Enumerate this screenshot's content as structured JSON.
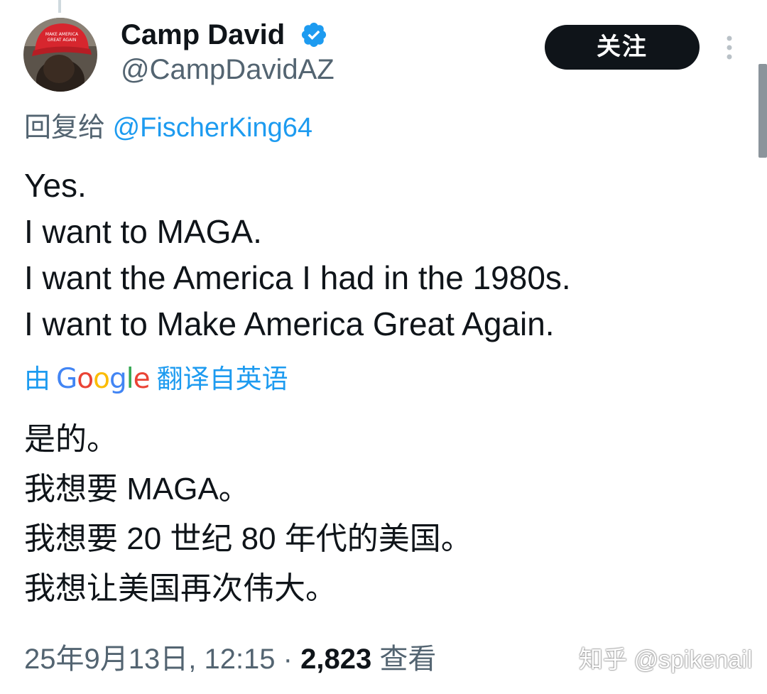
{
  "author": {
    "display_name": "Camp David",
    "handle": "@CampDavidAZ",
    "avatar_hat_text_line1": "MAKE AMERICA",
    "avatar_hat_text_line2": "GREAT AGAIN",
    "verified": true
  },
  "follow_button": {
    "label": "关注"
  },
  "reply": {
    "prefix": "回复给 ",
    "mention": "@FischerKing64"
  },
  "tweet": {
    "lines": [
      "Yes.",
      "I want to MAGA.",
      "I want the America I had in the 1980s.",
      "I want to Make America Great Again."
    ]
  },
  "translation": {
    "prefix": "由",
    "provider": "Google",
    "suffix": "翻译自英语",
    "lines": [
      "是的。",
      "我想要 MAGA。",
      "我想要 20 世纪 80 年代的美国。",
      "我想让美国再次伟大。"
    ]
  },
  "meta": {
    "timestamp": "25年9月13日, 12:15",
    "separator": " · ",
    "views_count": "2,823",
    "views_label": " 查看"
  },
  "watermark": {
    "text": "知乎 @spikenail"
  },
  "icons": {
    "verified": "verified-badge-icon",
    "more": "more-vertical-icon"
  },
  "colors": {
    "accent": "#1d9bf0",
    "primary_text": "#0f1419",
    "secondary_text": "#536471",
    "follow_button_bg": "#0f1419",
    "hat_red": "#d7262e"
  }
}
